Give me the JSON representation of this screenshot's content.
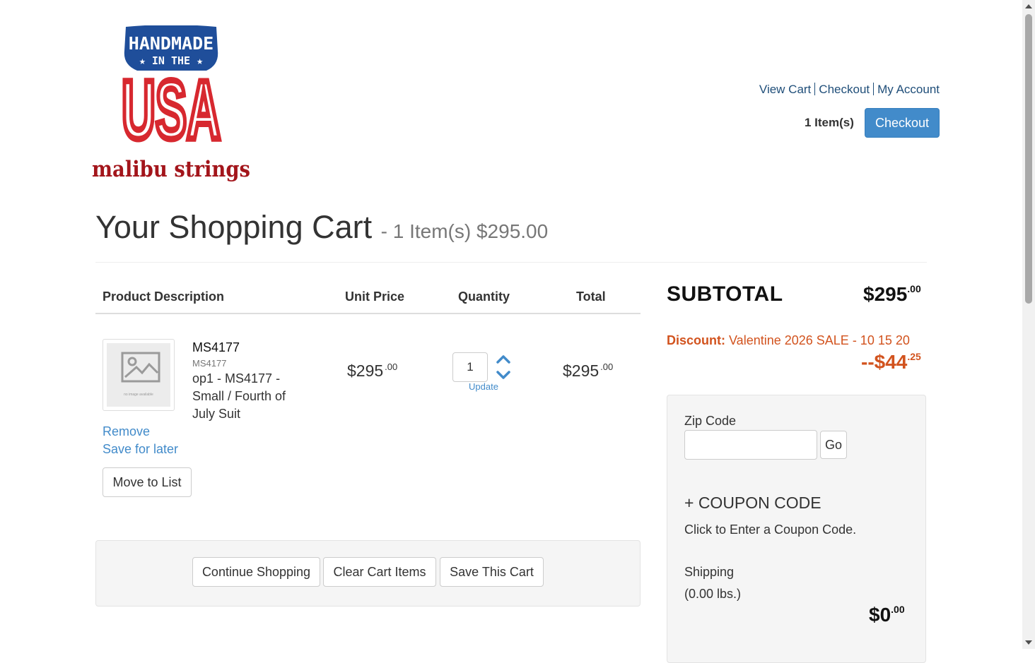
{
  "header": {
    "logo": {
      "top_text": "HANDMADE",
      "mid_text": "★ IN THE ★",
      "big_text": "USA",
      "brand_text": "malibu strings",
      "colors": {
        "blue": "#1f4e9a",
        "red": "#d7282f",
        "dark_red": "#a3151b"
      }
    },
    "links": [
      "View Cart",
      "Checkout",
      "My Account"
    ],
    "cart_count": "1 Item(s)",
    "checkout_button": "Checkout"
  },
  "cart": {
    "title": "Your Shopping Cart",
    "summary": "- 1 Item(s) $295.00",
    "columns": [
      "Product Description",
      "Unit Price",
      "Quantity",
      "Total"
    ],
    "item": {
      "thumb_caption": "no image available",
      "name": "MS4177",
      "sku": "MS4177",
      "description": "op1 - MS4177 - Small / Fourth of July Suit",
      "unit_price": "$295",
      "unit_price_cents": ".00",
      "quantity": "1",
      "update_label": "Update",
      "total": "$295",
      "total_cents": ".00",
      "remove_label": "Remove",
      "save_later_label": "Save for later",
      "move_to_list_label": "Move to List"
    },
    "actions": {
      "continue": "Continue Shopping",
      "clear": "Clear Cart Items",
      "save": "Save This Cart"
    }
  },
  "summary": {
    "subtotal_label": "SUBTOTAL",
    "subtotal_value": "$295",
    "subtotal_cents": ".00",
    "discount_label": "Discount:",
    "discount_text": "Valentine 2026 SALE - 10 15 20",
    "discount_value": "--$44",
    "discount_cents": ".25",
    "zip_label": "Zip Code",
    "zip_value": "",
    "go_label": "Go",
    "coupon_heading": "+ COUPON CODE",
    "coupon_sub": "Click to Enter a Coupon Code.",
    "shipping_label": "Shipping",
    "shipping_weight": "(0.00 lbs.)",
    "shipping_value": "$0",
    "shipping_cents": ".00",
    "discount_color": "#d2531e",
    "accent_color": "#428bca"
  }
}
